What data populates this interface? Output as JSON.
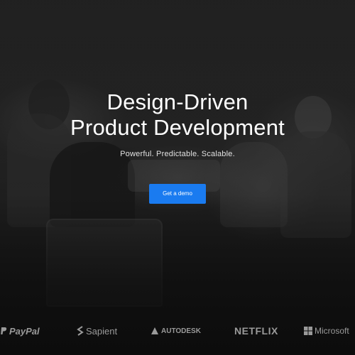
{
  "hero": {
    "headline_line1": "Design-Driven",
    "headline_line2": "Product Development",
    "tagline": "Powerful. Predictable. Scalable.",
    "cta_label": "Get a demo",
    "accent_color": "#1a7bf0"
  },
  "logos": [
    {
      "name": "PayPal",
      "icon": "paypal-icon"
    },
    {
      "name": "Sapient",
      "icon": "sapient-icon"
    },
    {
      "name": "AUTODESK",
      "icon": "autodesk-icon"
    },
    {
      "name": "NETFLIX",
      "icon": ""
    },
    {
      "name": "Microsoft",
      "icon": "microsoft-icon"
    }
  ]
}
